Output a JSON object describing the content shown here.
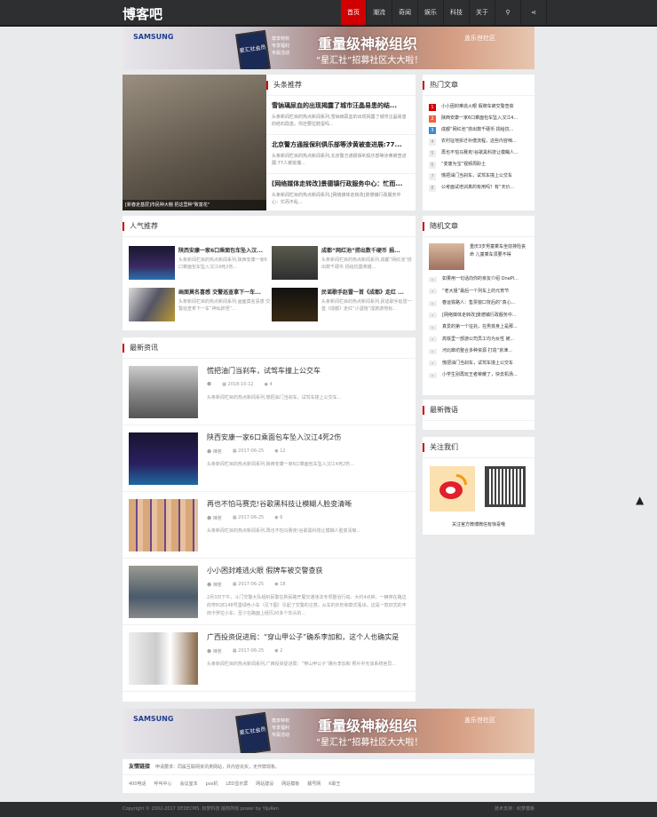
{
  "header": {
    "logo": "博客吧",
    "nav": [
      "首页",
      "潮流",
      "奇闻",
      "娱乐",
      "科技",
      "关于"
    ],
    "search_icon": "search-icon",
    "share_icon": "share-icon"
  },
  "banner": {
    "brand": "SAMSUNG",
    "card": "星汇社会员",
    "perks": [
      "尊享特权",
      "专享福利",
      "专属活动"
    ],
    "title": "重量级神秘组织",
    "subtitle": "“星汇社”招募社区大大啦！",
    "community": "盖乐世社区"
  },
  "slider": {
    "caption": "[新春走基层]市民种大棚 把这里种\"致富花\""
  },
  "headlines": {
    "title": "头条推荐",
    "items": [
      {
        "title": "雪钠璃尿血的出现揭露了城市汪晶易患的结...",
        "desc": "头条新闻栏目的热点新闻系列,雪钠璃尿血的出现揭露了城市汪晶易患的结石隐患，你还要拉肢蛋吗..."
      },
      {
        "title": "北京警方通报保利俱乐部等涉黄被查进展:77...",
        "desc": "头条新闻栏目的热点新闻系列,北京警方通报保利俱乐部等涉黄被查进展:77人被批捕..."
      },
      {
        "title": "[网络媒体走转改]景德镇行政服务中心：忙而...",
        "desc": "头条新闻栏目的热点新闻系列,[网络媒体走转改]景德镇行政服务中心：忙而不乱..."
      }
    ]
  },
  "hot": {
    "title": "热门文章",
    "items": [
      "小小困封难逃火眼 假牌车被交警查获",
      "陕西安康一家6口乘面包车坠入汉江4...",
      "成都“网红池”捞出数千硬币 捐给抗...",
      "农村征地拆迁补偿流程，这些内容咱...",
      "再也不怕马赛克!谷歌黑科技让模糊人...",
      "“变废为宝”视频周聆土",
      "慌把油门当刹车，试驾车撞上公交车",
      "公考面试培训真的有用吗？有“天价..."
    ]
  },
  "popular": {
    "title": "人气推荐",
    "items": [
      {
        "title": "陕西安康一家6口乘面包车坠入汉...",
        "desc": "头条新闻栏目的热点新闻系列,陕西安康一家6口乘面包车坠入汉江4死2伤..."
      },
      {
        "title": "成都“网红池”捞出数千硬币 捐...",
        "desc": "头条新闻栏目的热点新闻系列,成都“网红池”捞出数千硬币 捐给抗震英雄..."
      },
      {
        "title": "画面莫名喜感 交警巡查拿下一车...",
        "desc": "头条新闻栏目的热点新闻系列,画面莫名喜感 交警巡查拿下一车“神仙妖怪”..."
      },
      {
        "title": "民谣歌手赵雷一首《成都》走红 ...",
        "desc": "头条新闻栏目的热点新闻系列,民谣歌手赵雷一首《成都》走红“小酒馆”成旅游地标..."
      }
    ]
  },
  "latest": {
    "title": "最新资讯",
    "items": [
      {
        "title": "慌把油门当刹车，试驾车撞上公交车",
        "author": "",
        "date": "2018-10-12",
        "views": "4",
        "desc": "头条新闻栏目的热点新闻系列,慌把油门当刹车，试驾车撞上公交车..."
      },
      {
        "title": "陕西安康一家6口乘面包车坠入汉江4死2伤",
        "author": "楝茗",
        "date": "2017-06-25",
        "views": "12",
        "desc": "头条新闻栏目的热点新闻系列,陕西安康一家6口乘面包车坠入汉江4死2伤..."
      },
      {
        "title": "再也不怕马赛克!谷歌黑科技让模糊人脸变清晰",
        "author": "楝茗",
        "date": "2017-06-25",
        "views": "6",
        "desc": "头条新闻栏目的热点新闻系列,再也不怕马赛克!谷歌黑科技让模糊人脸变清晰..."
      },
      {
        "title": "小小困封难逃火眼 假牌车被交警查获",
        "author": "楝茗",
        "date": "2017-06-25",
        "views": "18",
        "desc": "2月3日下午，斗门交警大队组织民警在新民路开展交通违法专项整治行动。大约4点钟，一辆停在路边的粤EQE148号墨绿色小车（见下图）引起了交警的注意。从车的外形和款式看出，这是一款旧式的丰田卡罗拉小车，至少在路面上经历20多个年头的..."
      },
      {
        "title": "广西投资促进局：“穿山甲公子”确系李加和，这个人也确实是",
        "author": "楝茗",
        "date": "2017-06-25",
        "views": "2",
        "desc": "头条新闻栏目的热点新闻系列,广西投资促进局：“穿山甲公子”确为李加和 照片中无该系统官员..."
      }
    ]
  },
  "random": {
    "title": "随机文章",
    "feature": "重庆3岁男童乘车坐前排险丧命 儿童乘车须要不得",
    "items": [
      "如果用一句话向你的亲友介绍 OnePl...",
      "“老大姐”最后一个列车上的元宵节",
      "春运铁路人：售票窗口背后的“真心...",
      "[网络媒体走转改]景德镇行政服务中...",
      "真爱的第一个征兆，在男孩身上是那...",
      "高铁里一部游公司员工均为女性 被...",
      "河北廊坊整合多种资源 打造“京津...",
      "慌把油门当刹车，试驾车撞上公交车",
      "小学生别再玩王者荣耀了，快去机场..."
    ]
  },
  "weiyu": {
    "title": "最新微语"
  },
  "follow": {
    "title": "关注我们",
    "caption": "关注官方微博微信有惊喜哦"
  },
  "links": {
    "title": "友情链接",
    "note": "申请要求：同属互联网资讯类网站，并内容充实，无作弊现象。",
    "items": [
      "400电话",
      "呼叫中心",
      "会议室本",
      "pos机",
      "LED显示屏",
      "网站建设",
      "网站模板",
      "靓号网",
      "K歌王"
    ]
  },
  "footer": {
    "copyright": "Copyright © 2002-2017 DEDECMS. 织梦科技 版权所有 power by YijuRen",
    "support": "技术支持：织梦模板"
  },
  "colors": {
    "accent": "#d10000",
    "header": "#2e2f31"
  }
}
